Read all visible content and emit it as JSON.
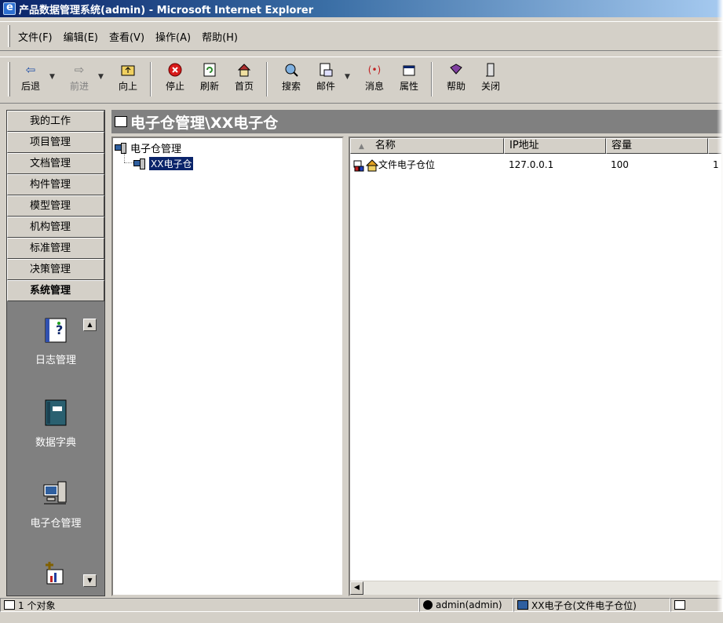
{
  "window": {
    "title": "产品数据管理系统(admin) - Microsoft Internet Explorer"
  },
  "menubar": {
    "items": [
      "文件(F)",
      "编辑(E)",
      "查看(V)",
      "操作(A)",
      "帮助(H)"
    ]
  },
  "toolbar": {
    "back": "后退",
    "forward": "前进",
    "up": "向上",
    "stop": "停止",
    "refresh": "刷新",
    "home": "首页",
    "search": "搜索",
    "mail": "邮件",
    "message": "消息",
    "properties": "属性",
    "help": "帮助",
    "close": "关闭"
  },
  "sidebar": {
    "nav": [
      "我的工作",
      "项目管理",
      "文档管理",
      "构件管理",
      "模型管理",
      "机构管理",
      "标准管理",
      "决策管理",
      "系统管理"
    ],
    "active": "系统管理",
    "panel_items": [
      "日志管理",
      "数据字典",
      "电子仓管理"
    ]
  },
  "header": {
    "title": "电子仓管理\\XX电子仓"
  },
  "tree": {
    "root": "电子仓管理",
    "child": "XX电子仓"
  },
  "list": {
    "columns": [
      "名称",
      "IP地址",
      "容量"
    ],
    "rows": [
      {
        "name": "文件电子仓位",
        "ip": "127.0.0.1",
        "capacity": "100",
        "extra": "1"
      }
    ]
  },
  "status": {
    "count": "1 个对象",
    "user": "admin(admin)",
    "location": "XX电子仓(文件电子仓位)"
  },
  "colors": {
    "titlebar_start": "#0a246a",
    "selection": "#0a246a",
    "panel_gray": "#808080"
  }
}
